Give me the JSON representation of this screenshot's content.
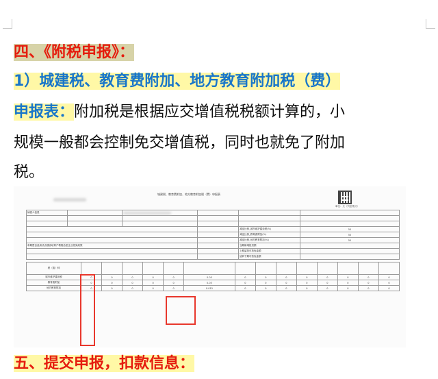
{
  "heading4": "四、《附税申报》：",
  "subheading": "1）城建税、教育费附加、地方教育附加税（费）",
  "intro": {
    "label": "申报表：",
    "line1": "附加税是根据应交增值税税额计算的，小",
    "line2": "规模一般都会控制免交增值税，同时也就免了附加",
    "line3": "税。"
  },
  "form": {
    "title": "城建税、教育费附加、地方教育附加税（费）申报表",
    "unit_label": "单位：元（列至角分）",
    "taxpayer_label": "纳税人信息",
    "section_label": "本期是否适用试点建设培育产教融合型企业抵免政策",
    "col_index_label": "税（费）种",
    "rows": [
      {
        "name": "城市维护建设税",
        "rate": "0.05"
      },
      {
        "name": "教育费附加",
        "rate": "0.03"
      },
      {
        "name": "地方教育附加",
        "rate": "0.015"
      }
    ],
    "right_rows": [
      "减征比例_城市维护建设税(%)",
      "减征比例_教育费附加(%)",
      "减征比例_地方教育附加(%)",
      "当期新增投资额",
      "上期留抵可抵免金额",
      "结转下期可抵免金额"
    ],
    "right_values": [
      "50",
      "50",
      "50"
    ],
    "zero": "0"
  },
  "heading5": "五、提交申报，扣款信息："
}
